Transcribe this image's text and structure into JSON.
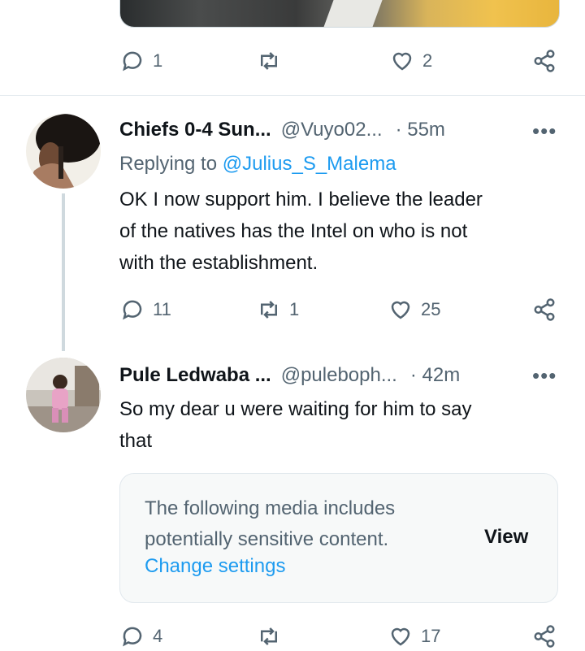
{
  "top_tweet_actions": {
    "replies": "1",
    "retweets": "",
    "likes": "2"
  },
  "tweets": [
    {
      "display_name": "Chiefs 0-4 Sun...",
      "handle": "@Vuyo02...",
      "time": "· 55m",
      "replying_label": "Replying to",
      "replying_handle": "@Julius_S_Malema",
      "text_lines": [
        "OK I now support him. I believe the leader",
        "of the natives has the Intel on who is not",
        "with the establishment."
      ],
      "replies": "11",
      "retweets": "1",
      "likes": "25"
    },
    {
      "display_name": "Pule Ledwaba ...",
      "handle": "@puleboph...",
      "time": "· 42m",
      "text_lines": [
        "So my dear u were waiting for him to say",
        "that"
      ],
      "sensitive": {
        "line1": "The following media includes",
        "line2": "potentially sensitive content.",
        "change_settings": "Change settings",
        "view": "View"
      },
      "replies": "4",
      "retweets": "",
      "likes": "17"
    }
  ],
  "more_glyph": "•••",
  "colors": {
    "link": "#1d9bf0",
    "muted": "#536471",
    "text": "#0f1419"
  }
}
